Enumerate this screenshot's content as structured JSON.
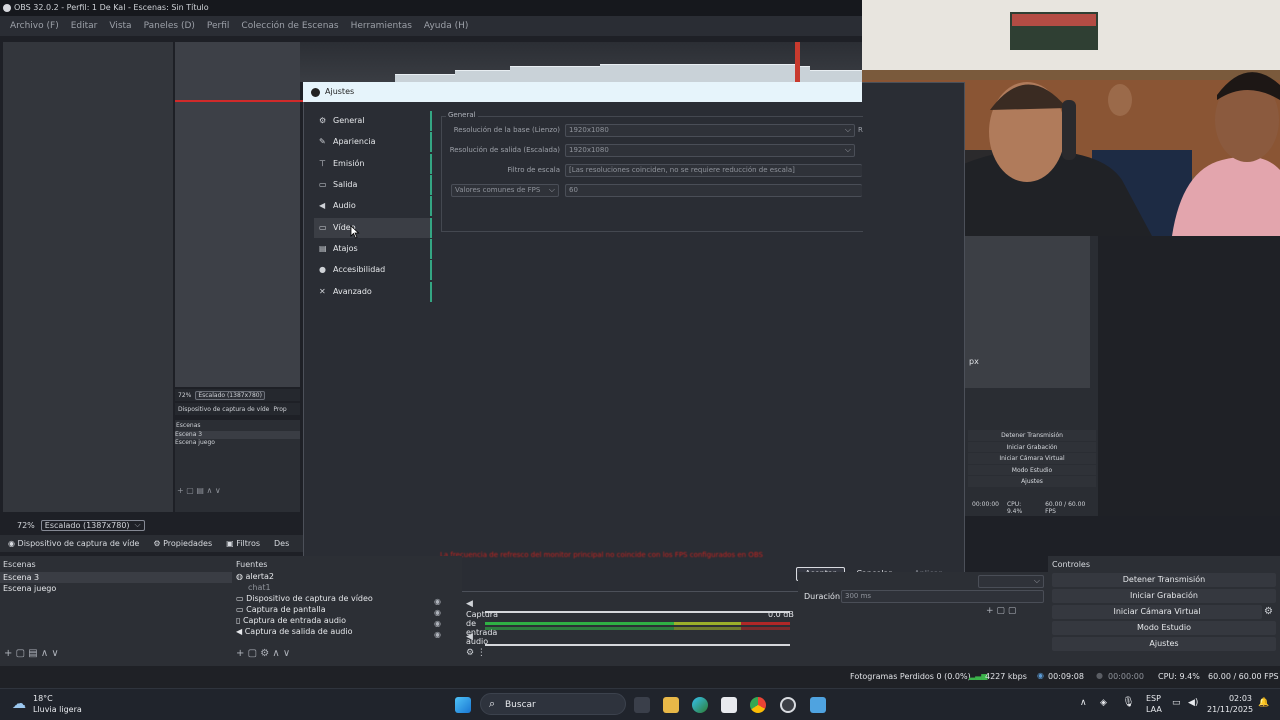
{
  "window": {
    "title": "OBS 32.0.2 - Perfil: 1 De Kal - Escenas: Sin Título"
  },
  "menu": [
    "Archivo (F)",
    "Editar",
    "Vista",
    "Paneles (D)",
    "Perfil",
    "Colección de Escenas",
    "Herramientas",
    "Ayuda (H)"
  ],
  "nested": {
    "zoom": "72%",
    "scale": "Escalado (1387x780)",
    "source": "Dispositivo de captura de víde",
    "props": "Prop",
    "scenes_title": "Escenas",
    "scenes": [
      "Escena 3",
      "Escena juego"
    ],
    "px": "px",
    "controls": [
      "Detener Transmisión",
      "Iniciar Grabación",
      "Iniciar Cámara Virtual",
      "Modo Estudio",
      "Ajustes"
    ],
    "time": "00:00:00",
    "cpu": "CPU: 9.4%",
    "fps": "60.00 / 60.00 FPS"
  },
  "dialog": {
    "title": "Ajustes",
    "categories": [
      {
        "label": "General",
        "icon": "gear-icon"
      },
      {
        "label": "Apariencia",
        "icon": "brush-icon"
      },
      {
        "label": "Emisión",
        "icon": "broadcast-icon"
      },
      {
        "label": "Salida",
        "icon": "output-icon"
      },
      {
        "label": "Audio",
        "icon": "speaker-icon"
      },
      {
        "label": "Vídeo",
        "icon": "monitor-icon"
      },
      {
        "label": "Atajos",
        "icon": "keyboard-icon"
      },
      {
        "label": "Accesibilidad",
        "icon": "accessibility-icon"
      },
      {
        "label": "Avanzado",
        "icon": "wrench-icon"
      }
    ],
    "selected_category": "Vídeo",
    "group_label": "General",
    "base_res_label": "Resolución de la base (Lienzo)",
    "base_res_value": "1920x1080",
    "base_res_suffix": "R",
    "out_res_label": "Resolución de salida (Escalada)",
    "out_res_value": "1920x1080",
    "filter_label": "Filtro de escala",
    "filter_value": "[Las resoluciones coinciden, no se requiere reducción de escala]",
    "fps_type": "Valores comunes de FPS",
    "fps_value": "60",
    "error_text": "La frecuencia de refresco del monitor principal no coincide con los FPS configurados en OBS",
    "buttons": {
      "ok": "Aceptar",
      "cancel": "Cancelar",
      "apply": "Aplicar"
    }
  },
  "main": {
    "zoom": "72%",
    "scale": "Escalado (1387x780)",
    "tabs": [
      "Dispositivo de captura de víde",
      "Propiedades",
      "Filtros",
      "Des"
    ],
    "scenes_title": "Escenas",
    "scenes": [
      "Escena 3",
      "Escena juego"
    ],
    "sources_title": "Fuentes",
    "sources": [
      "alerta2",
      "chat1",
      "Dispositivo de captura de vídeo",
      "Captura de pantalla",
      "Captura de entrada audio",
      "Captura de salida de audio"
    ],
    "mixer_item": "Captura de entrada audio",
    "mixer_db": "0.0 dB",
    "duration_label": "Duración",
    "duration_value": "300 ms",
    "controls_title": "Controles",
    "controls": [
      "Detener Transmisión",
      "Iniciar Grabación",
      "Iniciar Cámara Virtual",
      "Modo Estudio",
      "Ajustes"
    ]
  },
  "status": {
    "dropped": "Fotogramas Perdidos 0 (0.0%)",
    "bitrate": "4227 kbps",
    "stream_time": "00:09:08",
    "rec_time": "00:00:00",
    "cpu": "CPU: 9.4%",
    "fps": "60.00 / 60.00 FPS"
  },
  "taskbar": {
    "weather_temp": "18°C",
    "weather_desc": "Lluvia ligera",
    "search": "Buscar",
    "lang1": "ESP",
    "lang2": "LAA",
    "time": "02:03",
    "date": "21/11/2025"
  },
  "colors": {
    "accent": "#34a683",
    "error": "#c4231f",
    "title_bg": "#e6f4fb"
  }
}
